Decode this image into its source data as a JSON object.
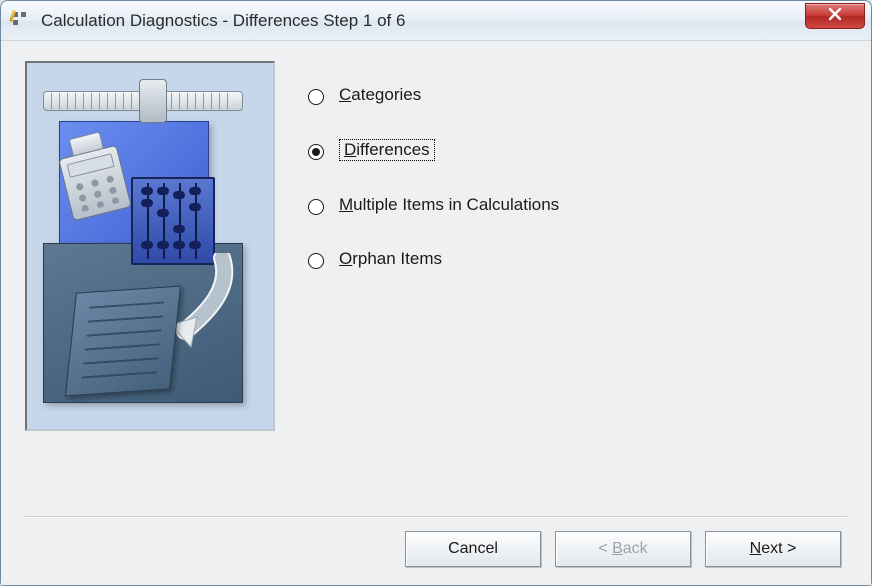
{
  "window": {
    "title": "Calculation Diagnostics - Differences Step 1 of 6",
    "icon": "calculator-wizard-icon"
  },
  "options": [
    {
      "key": "categories",
      "label": "Categories",
      "accel": "C",
      "selected": false
    },
    {
      "key": "differences",
      "label": "Differences",
      "accel": "D",
      "selected": true
    },
    {
      "key": "multiple",
      "label": "Multiple Items in Calculations",
      "accel": "M",
      "selected": false
    },
    {
      "key": "orphan",
      "label": "Orphan Items",
      "accel": "O",
      "selected": false
    }
  ],
  "buttons": {
    "cancel": {
      "label": "Cancel",
      "accel": "",
      "enabled": true
    },
    "back": {
      "label": "< Back",
      "accel": "B",
      "enabled": false
    },
    "next": {
      "label": "Next >",
      "accel": "N",
      "enabled": true
    }
  }
}
